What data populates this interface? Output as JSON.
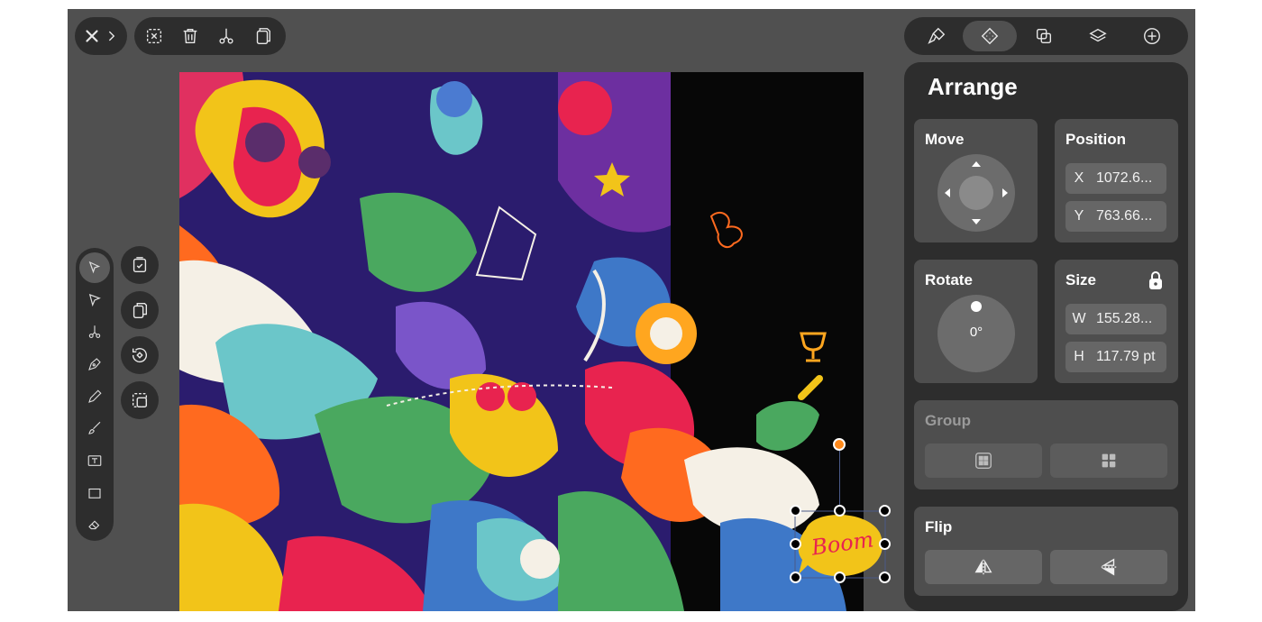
{
  "toolbar_left": {
    "close_icon": "close-icon",
    "expand_icon": "chevron-right-icon",
    "actions": [
      "deselect-icon",
      "trash-icon",
      "scissors-icon",
      "copy-icon"
    ]
  },
  "toolbar_right": {
    "tabs": [
      "style-icon",
      "arrange-icon",
      "path-ops-icon",
      "layers-icon",
      "insert-icon"
    ],
    "active_tab": "arrange"
  },
  "left_tools": [
    "select-tool",
    "direct-select-tool",
    "scissors-tool",
    "pen-tool",
    "pencil-tool",
    "brush-tool",
    "text-tool",
    "rectangle-tool",
    "eraser-tool"
  ],
  "quick_actions": [
    "select-all-icon",
    "duplicate-icon",
    "repeat-transform-icon",
    "transform-box-icon"
  ],
  "panel": {
    "title": "Arrange",
    "move": {
      "label": "Move"
    },
    "position": {
      "label": "Position",
      "x_label": "X",
      "x_value": "1072.6...",
      "y_label": "Y",
      "y_value": "763.66..."
    },
    "rotate": {
      "label": "Rotate",
      "value": "0°"
    },
    "size": {
      "label": "Size",
      "w_label": "W",
      "w_value": "155.28...",
      "h_label": "H",
      "h_value": "117.79 pt",
      "lock_icon": "lock-icon"
    },
    "group": {
      "label": "Group",
      "buttons": [
        "group-icon",
        "ungroup-icon"
      ]
    },
    "flip": {
      "label": "Flip",
      "buttons": [
        "flip-horizontal-icon",
        "flip-vertical-icon"
      ]
    }
  },
  "selection": {
    "text": "Boom"
  },
  "colors": {
    "app_bg": "#505050",
    "toolbar_bg": "#2d2d2d",
    "card_bg": "#4e4e4e",
    "field_bg": "#666666",
    "handle_accent": "#ff8a1c",
    "boom_fill": "#f2c419",
    "boom_text": "#e8234f"
  }
}
